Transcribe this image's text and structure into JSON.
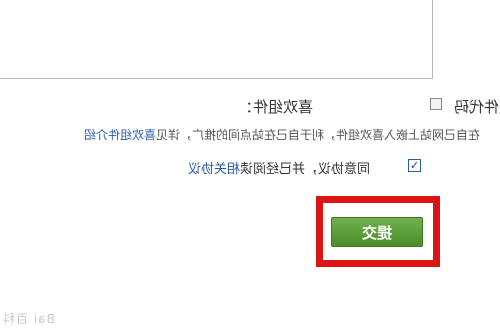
{
  "form": {
    "widget_section_label": "喜欢组件：",
    "need_widget_code_label": "需要获取喜欢组件代码",
    "hint_text": "在自己网站上嵌入喜欢组件，利于自己在站点间的推广，详见",
    "hint_link": "喜欢组件介绍",
    "agree_prefix": "同意协议，并已经阅读",
    "agree_link": "相关协议",
    "agree_checked_mark": "✓",
    "submit_label": "提交"
  },
  "watermark": "Bai 百科",
  "colors": {
    "accent_red": "#d91515",
    "button_green": "#5a9e36",
    "link_blue": "#2a5caa"
  }
}
